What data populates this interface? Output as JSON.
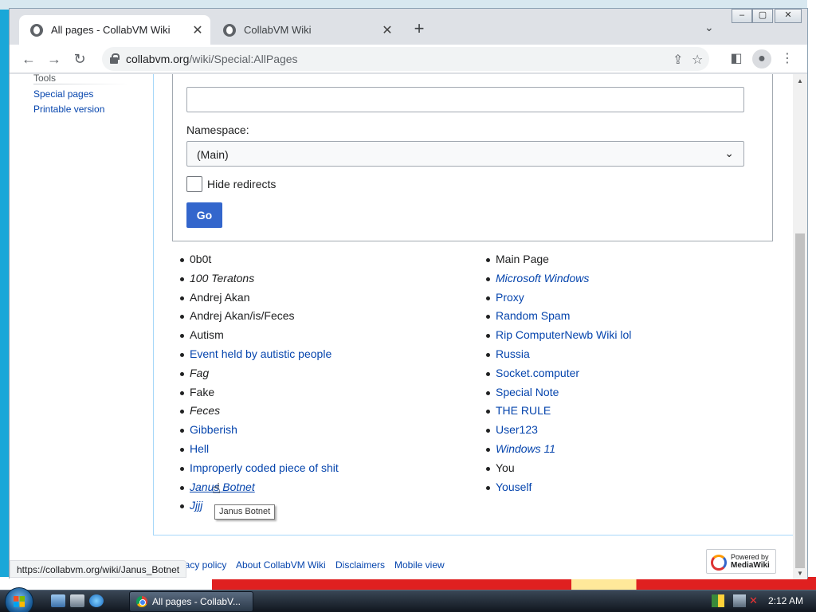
{
  "browser": {
    "tabs": [
      {
        "title": "All pages - CollabVM Wiki",
        "close": "✕"
      },
      {
        "title": "CollabVM Wiki",
        "close": "✕"
      }
    ],
    "new_tab": "+",
    "tab_dropdown": "⌄",
    "window_controls": {
      "minimize": "–",
      "maximize": "▢",
      "close": "✕"
    },
    "url_host": "collabvm.org",
    "url_path": "/wiki/Special:AllPages"
  },
  "sidebar": {
    "section": "Tools",
    "links": [
      "Special pages",
      "Printable version"
    ]
  },
  "form": {
    "namespace_label": "Namespace:",
    "namespace_value": "(Main)",
    "hide_redirects_label": "Hide redirects",
    "go_label": "Go"
  },
  "pages_left": [
    {
      "title": "0b0t",
      "style": "dark"
    },
    {
      "title": "100 Teratons",
      "style": "dark ital"
    },
    {
      "title": "Andrej Akan",
      "style": "dark"
    },
    {
      "title": "Andrej Akan/is/Feces",
      "style": "dark"
    },
    {
      "title": "Autism",
      "style": "dark"
    },
    {
      "title": "Event held by autistic people",
      "style": ""
    },
    {
      "title": "Fag",
      "style": "dark ital"
    },
    {
      "title": "Fake",
      "style": "dark"
    },
    {
      "title": "Feces",
      "style": "dark ital"
    },
    {
      "title": "Gibberish",
      "style": ""
    },
    {
      "title": "Hell",
      "style": ""
    },
    {
      "title": "Improperly coded piece of shit",
      "style": ""
    },
    {
      "title": "Janus Botnet",
      "style": "ital hover"
    },
    {
      "title": "Jjjj",
      "style": "ital"
    }
  ],
  "pages_right": [
    {
      "title": "Main Page",
      "style": "dark"
    },
    {
      "title": "Microsoft Windows",
      "style": "ital"
    },
    {
      "title": "Proxy",
      "style": ""
    },
    {
      "title": "Random Spam",
      "style": ""
    },
    {
      "title": "Rip ComputerNewb Wiki lol",
      "style": ""
    },
    {
      "title": "Russia",
      "style": ""
    },
    {
      "title": "Socket.computer",
      "style": ""
    },
    {
      "title": "Special Note",
      "style": ""
    },
    {
      "title": "THE RULE",
      "style": ""
    },
    {
      "title": "User123",
      "style": ""
    },
    {
      "title": "Windows 11",
      "style": "ital"
    },
    {
      "title": "You",
      "style": "dark"
    },
    {
      "title": "Youself",
      "style": ""
    }
  ],
  "tooltip": "Janus Botnet",
  "footer": {
    "links": [
      "Privacy policy",
      "About CollabVM Wiki",
      "Disclaimers",
      "Mobile view"
    ],
    "badge_top": "Powered by",
    "badge_bottom": "MediaWiki"
  },
  "status_url": "https://collabvm.org/wiki/Janus_Botnet",
  "taskbar": {
    "task_label": "All pages - CollabV...",
    "clock": "2:12 AM"
  }
}
